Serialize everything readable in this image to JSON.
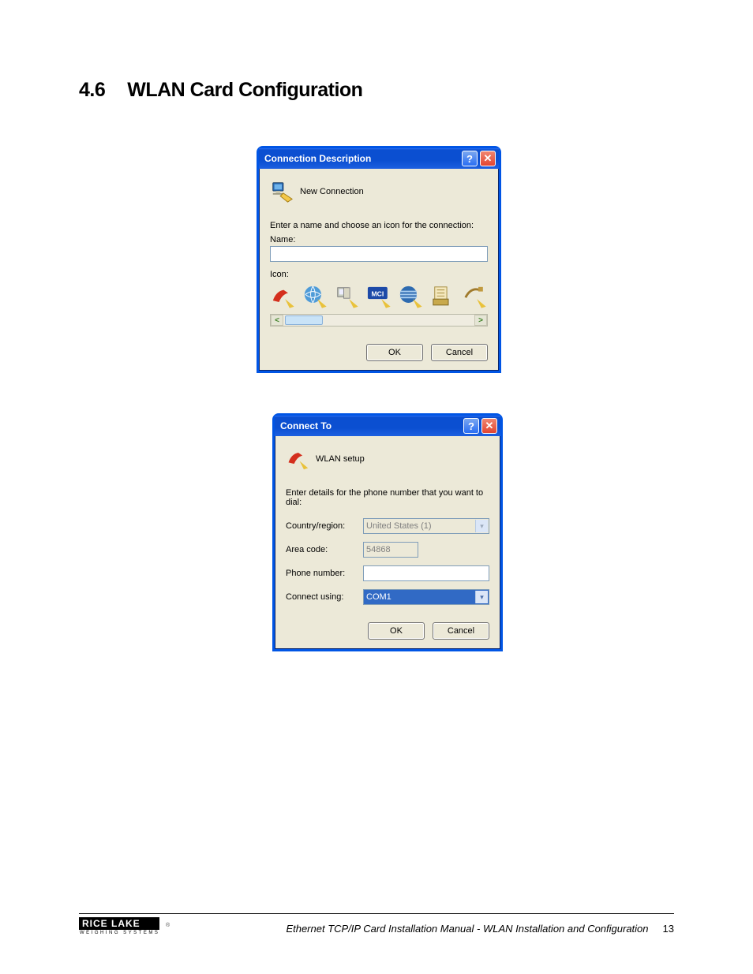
{
  "heading": {
    "number": "4.6",
    "title": "WLAN Card Configuration"
  },
  "dialog1": {
    "title": "Connection Description",
    "header_label": "New Connection",
    "prompt": "Enter a name and choose an icon for the connection:",
    "name_label": "Name:",
    "name_value": "",
    "icon_label": "Icon:",
    "ok": "OK",
    "cancel": "Cancel"
  },
  "dialog2": {
    "title": "Connect To",
    "header_label": "WLAN setup",
    "prompt": "Enter details for the phone number that you want to dial:",
    "country_label": "Country/region:",
    "country_value": "United States (1)",
    "area_label": "Area code:",
    "area_value": "54868",
    "phone_label": "Phone number:",
    "phone_value": "",
    "connect_label": "Connect using:",
    "connect_value": "COM1",
    "ok": "OK",
    "cancel": "Cancel"
  },
  "footer": {
    "logo_top": "RICE LAKE",
    "logo_sub": "WEIGHING SYSTEMS",
    "text": "Ethernet TCP/IP Card Installation Manual - WLAN Installation and Configuration",
    "page": "13"
  }
}
